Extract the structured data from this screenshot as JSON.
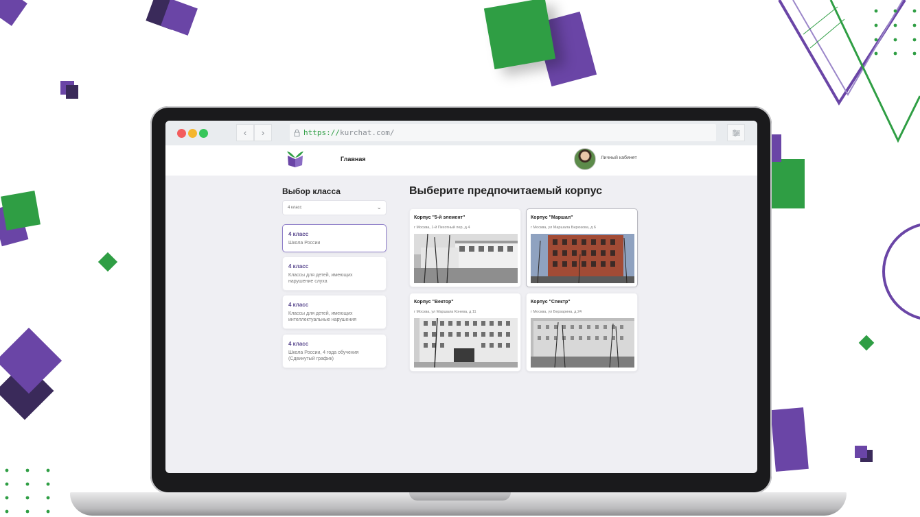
{
  "browser": {
    "url_protocol": "https://",
    "url_rest": "kurchat.com/",
    "back_icon": "chevron-left-icon",
    "forward_icon": "chevron-right-icon"
  },
  "header": {
    "nav_home": "Главная",
    "cabinet_label": "Личный кабинет"
  },
  "sidebar": {
    "title": "Выбор класса",
    "select_value": "4 класс",
    "items": [
      {
        "title": "4 класс",
        "subtitle": "Школа России"
      },
      {
        "title": "4 класс",
        "subtitle": "Классы для детей, имеющих нарушение слуха"
      },
      {
        "title": "4 класс",
        "subtitle": "Классы для детей, имеющих интеллектуальные нарушения"
      },
      {
        "title": "4 класс",
        "subtitle": "Школа России, 4 года обучения (Сдвинутый график)"
      }
    ]
  },
  "main": {
    "title": "Выберите предпочитаемый корпус",
    "buildings": [
      {
        "name": "Корпус \"5-й элемент\"",
        "address": "г Москва, 1-й Пехотный пер, д 4"
      },
      {
        "name": "Корпус \"Маршал\"",
        "address": "г Москва, ул Маршала Бирюзова, д 6"
      },
      {
        "name": "Корпус \"Вектор\"",
        "address": "г Москва, ул Маршала Конева, д 11"
      },
      {
        "name": "Корпус \"Спектр\"",
        "address": "г Москва, ул Берзарина, д 24"
      }
    ]
  },
  "colors": {
    "accent_purple": "#6a45a6",
    "accent_green": "#2f9e44"
  }
}
